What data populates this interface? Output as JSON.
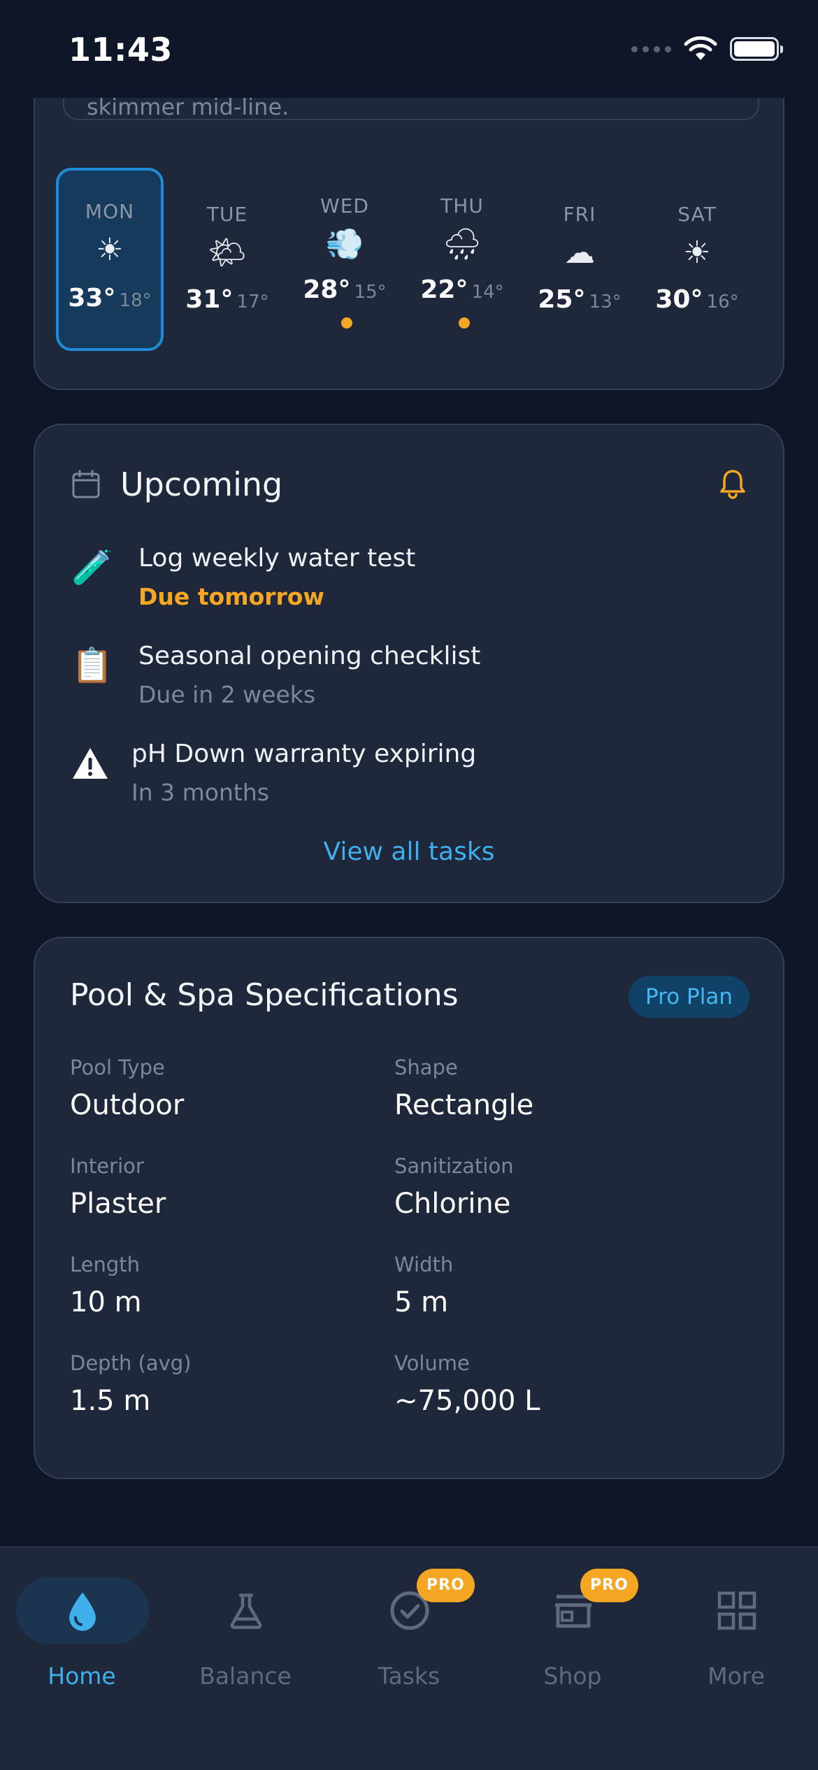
{
  "status_bar": {
    "time": "11:43"
  },
  "weather": {
    "note_text": "skimmer mid-line.",
    "days": [
      {
        "name": "MON",
        "icon": "☀",
        "icon_name": "sun-icon",
        "hi": "33°",
        "lo": "18°",
        "selected": true,
        "alert": false
      },
      {
        "name": "TUE",
        "icon": "🌤",
        "icon_name": "sun-behind-cloud-icon",
        "hi": "31°",
        "lo": "17°",
        "selected": false,
        "alert": false
      },
      {
        "name": "WED",
        "icon": "💨",
        "icon_name": "wind-icon",
        "hi": "28°",
        "lo": "15°",
        "selected": false,
        "alert": true
      },
      {
        "name": "THU",
        "icon": "🌧",
        "icon_name": "rain-cloud-icon",
        "hi": "22°",
        "lo": "14°",
        "selected": false,
        "alert": true
      },
      {
        "name": "FRI",
        "icon": "☁",
        "icon_name": "cloud-icon",
        "hi": "25°",
        "lo": "13°",
        "selected": false,
        "alert": false
      },
      {
        "name": "SAT",
        "icon": "☀",
        "icon_name": "sun-icon",
        "hi": "30°",
        "lo": "16°",
        "selected": false,
        "alert": false
      }
    ]
  },
  "upcoming": {
    "title": "Upcoming",
    "tasks": [
      {
        "icon": "🧪",
        "icon_name": "test-tube-icon",
        "title": "Log weekly water test",
        "sub": "Due tomorrow",
        "due_soon": true
      },
      {
        "icon": "📋",
        "icon_name": "clipboard-icon",
        "title": "Seasonal opening checklist",
        "sub": "Due in 2 weeks",
        "due_soon": false
      },
      {
        "icon": "⚠",
        "icon_name": "warning-icon",
        "title": "pH Down warranty expiring",
        "sub": "In 3 months",
        "due_soon": false
      }
    ],
    "view_all": "View all tasks"
  },
  "specs": {
    "title": "Pool & Spa Specifications",
    "plan_badge": "Pro Plan",
    "items": [
      {
        "label": "Pool Type",
        "value": "Outdoor"
      },
      {
        "label": "Shape",
        "value": "Rectangle"
      },
      {
        "label": "Interior",
        "value": "Plaster"
      },
      {
        "label": "Sanitization",
        "value": "Chlorine"
      },
      {
        "label": "Length",
        "value": "10 m"
      },
      {
        "label": "Width",
        "value": "5 m"
      },
      {
        "label": "Depth (avg)",
        "value": "1.5 m"
      },
      {
        "label": "Volume",
        "value": "~75,000 L"
      }
    ]
  },
  "tab_bar": {
    "tabs": [
      {
        "label": "Home",
        "icon_name": "water-drop-icon",
        "active": true,
        "pro": false
      },
      {
        "label": "Balance",
        "icon_name": "flask-icon",
        "active": false,
        "pro": false
      },
      {
        "label": "Tasks",
        "icon_name": "check-circle-icon",
        "active": false,
        "pro": true
      },
      {
        "label": "Shop",
        "icon_name": "store-icon",
        "active": false,
        "pro": true
      },
      {
        "label": "More",
        "icon_name": "grid-icon",
        "active": false,
        "pro": false
      }
    ],
    "pro_badge": "PRO"
  },
  "colors": {
    "background": "#0e1627",
    "card": "#1e283a",
    "accent_blue": "#3fb0ec",
    "accent_orange": "#f5a623"
  }
}
